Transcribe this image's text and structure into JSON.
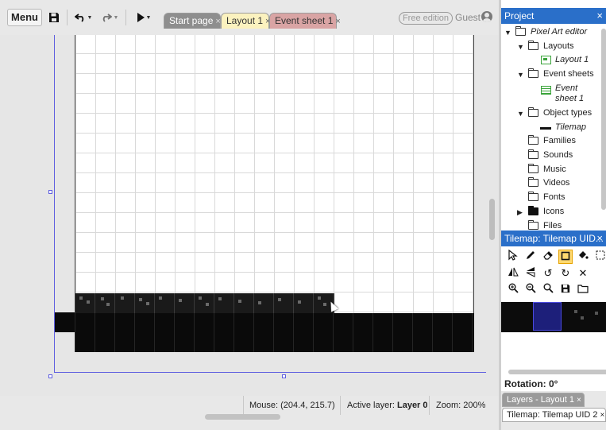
{
  "toolbar": {
    "menu_label": "Menu",
    "icons": [
      "save-icon",
      "undo-icon",
      "redo-icon",
      "play-icon"
    ],
    "tabs": [
      {
        "label": "Start page",
        "close": "×",
        "color": "#8e8e8e"
      },
      {
        "label": "Layout 1",
        "close": "×",
        "color": "#fbf2bf"
      },
      {
        "label": "Event sheet 1",
        "close": "×",
        "color": "#d9a4a4"
      }
    ],
    "edition_badge": "Free edition",
    "user_label": "Guest"
  },
  "status_bar": {
    "mouse_prefix": "Mouse:",
    "mouse_value": "(204.4, 215.7)",
    "layer_prefix": "Active layer:",
    "layer_value": "Layer 0",
    "zoom_prefix": "Zoom:",
    "zoom_value": "200%"
  },
  "project_panel": {
    "title": "Project",
    "close": "×",
    "tree": {
      "root": "Pixel Art editor",
      "layouts": "Layouts",
      "layout_1": "Layout 1",
      "event_sheets": "Event sheets",
      "event_sheet_1": "Event sheet 1",
      "object_types": "Object types",
      "tilemap": "Tilemap",
      "families": "Families",
      "sounds": "Sounds",
      "music": "Music",
      "videos": "Videos",
      "fonts": "Fonts",
      "icons": "Icons",
      "files": "Files"
    }
  },
  "tilemap_panel": {
    "title": "Tilemap: Tilemap UID...",
    "close": "×",
    "tools_row1": [
      "cursor-icon",
      "pencil-icon",
      "eraser-icon",
      "rectangle-icon",
      "fill-bucket-icon",
      "selection-icon"
    ],
    "tools_row2": [
      "flip-horizontal-icon",
      "flip-vertical-icon",
      "rotate-ccw-icon",
      "rotate-cw-icon",
      "clear-icon"
    ],
    "tools_row3": [
      "zoom-in-icon",
      "zoom-out-icon",
      "zoom-reset-icon",
      "save-icon",
      "folder-icon"
    ],
    "active_tool": "rectangle-icon"
  },
  "rotation": {
    "label": "Rotation: 0°"
  },
  "bottom_tabs": {
    "layers": "Layers - Layout 1",
    "tilemap": "Tilemap: Tilemap UID 2",
    "close": "×"
  },
  "colors": {
    "accent": "#2a6fc9",
    "layout_bound": "#5f5fe0",
    "active_tool": "#ffd970"
  }
}
